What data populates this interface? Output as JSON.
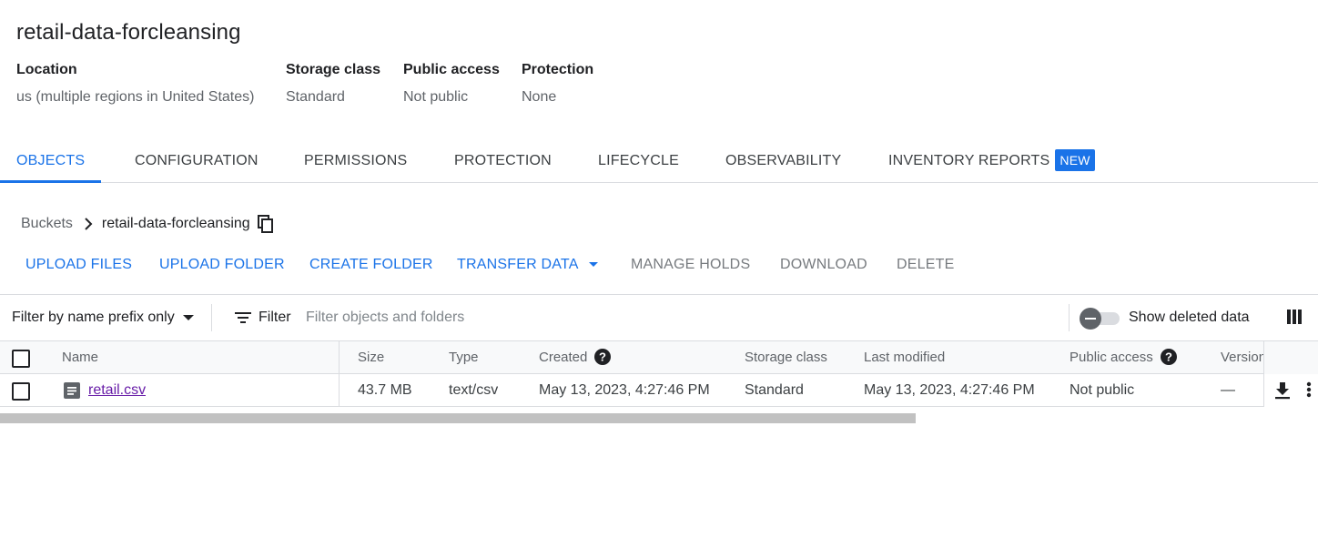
{
  "bucket": {
    "title": "retail-data-forcleansing"
  },
  "meta": [
    {
      "label": "Location",
      "value": "us (multiple regions in United States)"
    },
    {
      "label": "Storage class",
      "value": "Standard"
    },
    {
      "label": "Public access",
      "value": "Not public"
    },
    {
      "label": "Protection",
      "value": "None"
    }
  ],
  "tabs": [
    {
      "label": "OBJECTS",
      "active": true
    },
    {
      "label": "CONFIGURATION"
    },
    {
      "label": "PERMISSIONS"
    },
    {
      "label": "PROTECTION"
    },
    {
      "label": "LIFECYCLE"
    },
    {
      "label": "OBSERVABILITY"
    },
    {
      "label": "INVENTORY REPORTS",
      "badge": "NEW"
    }
  ],
  "breadcrumb": {
    "root": "Buckets",
    "current": "retail-data-forcleansing"
  },
  "toolbar": {
    "upload_files": "UPLOAD FILES",
    "upload_folder": "UPLOAD FOLDER",
    "create_folder": "CREATE FOLDER",
    "transfer_data": "TRANSFER DATA",
    "manage_holds": "MANAGE HOLDS",
    "download": "DOWNLOAD",
    "delete": "DELETE"
  },
  "filter": {
    "mode": "Filter by name prefix only",
    "filter_label": "Filter",
    "placeholder": "Filter objects and folders",
    "show_deleted_label": "Show deleted data",
    "show_deleted_on": false
  },
  "table": {
    "headers": {
      "name": "Name",
      "size": "Size",
      "type": "Type",
      "created": "Created",
      "storage_class": "Storage class",
      "last_modified": "Last modified",
      "public_access": "Public access",
      "version": "Version"
    },
    "rows": [
      {
        "name": "retail.csv",
        "size": "43.7 MB",
        "type": "text/csv",
        "created": "May 13, 2023, 4:27:46 PM",
        "storage_class": "Standard",
        "last_modified": "May 13, 2023, 4:27:46 PM",
        "public_access": "Not public",
        "version": "—"
      }
    ]
  },
  "colors": {
    "accent": "#1a73e8",
    "visited_link": "#681da8"
  },
  "icons": [
    "copy-icon",
    "chevron-right-icon",
    "caret-down-icon",
    "filter-list-icon",
    "column-display-icon",
    "help-icon",
    "file-icon",
    "download-icon",
    "more-vert-icon"
  ]
}
